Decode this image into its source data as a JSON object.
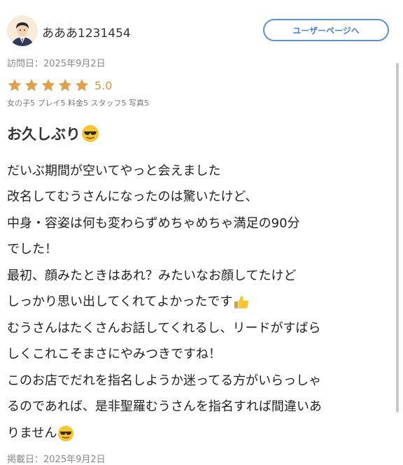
{
  "user": {
    "name": "あああ1231454",
    "page_button": "ユーザーページへ",
    "avatar_icon": "person-avatar"
  },
  "visit_date": "訪問日：2025年9月2日",
  "rating": {
    "value": "5.0",
    "stars": 5,
    "max_stars": 5,
    "color": "#e0a050",
    "breakdown": "女の子5 プレイ5 料金5 スタッフ5 写真5"
  },
  "review": {
    "title": "お久しぶり",
    "title_icon": "sunglasses-emoji",
    "lines": [
      "だいぶ期間が空いてやっと会えました",
      "改名してむうさんになったのは驚いたけど、",
      "中身・容姿は何も変わらずめちゃめちゃ満足の90分",
      "でした！",
      "最初、顔みたときはあれ？みたいなお顔してたけど",
      "しっかり思い出してくれてよかったです",
      "むうさんはたくさんお話してくれるし、リードがすばら",
      "しくこれこそまさにやみつきですね！",
      "このお店でだれを指名しようか迷ってる方がいらっしゃ",
      "るのであれば、是非聖羅むうさんを指名すれば間違いあ",
      "りません"
    ],
    "thumbs_icon": "thumbs-up-emoji",
    "end_icon": "sunglasses-emoji"
  },
  "posted_date": "掲載日：2025年9月2日"
}
